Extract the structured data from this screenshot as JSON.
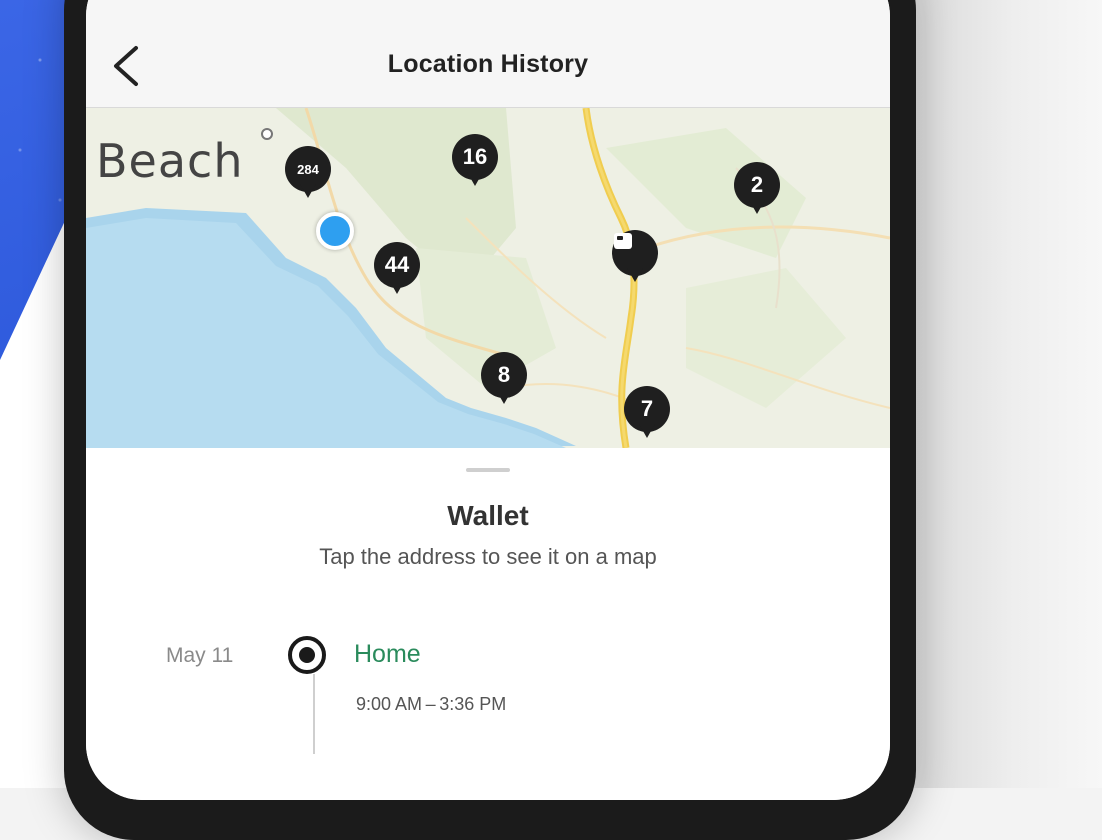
{
  "header": {
    "title": "Location History"
  },
  "map": {
    "place_label": "Beach",
    "pins": [
      {
        "label": "284",
        "kind": "count"
      },
      {
        "label": "16",
        "kind": "count"
      },
      {
        "label": "2",
        "kind": "count"
      },
      {
        "label": "44",
        "kind": "count"
      },
      {
        "label": "",
        "kind": "device"
      },
      {
        "label": "8",
        "kind": "count"
      },
      {
        "label": "7",
        "kind": "count"
      }
    ]
  },
  "sheet": {
    "title": "Wallet",
    "subtitle": "Tap the address to see it on a map",
    "entries": [
      {
        "date": "May 11",
        "place": "Home",
        "time": "9:00 AM – 3:36 PM"
      }
    ]
  },
  "colors": {
    "accent_green": "#2a8b5c",
    "pin": "#1f1f1f",
    "location_blue": "#2e9ff0",
    "background_blue": "#2c58da"
  }
}
